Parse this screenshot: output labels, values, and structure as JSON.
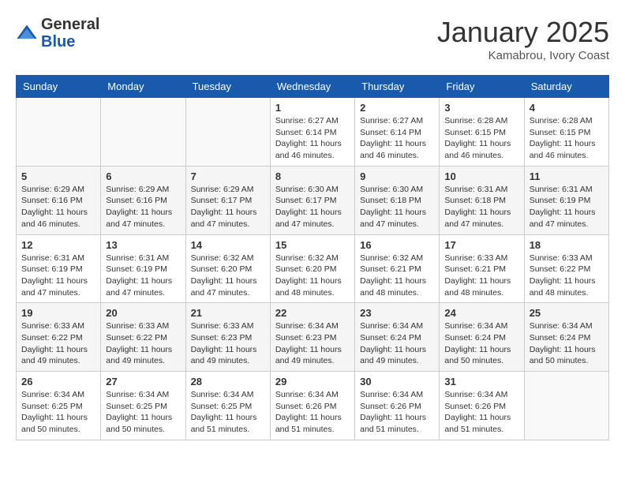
{
  "logo": {
    "general": "General",
    "blue": "Blue"
  },
  "header": {
    "month": "January 2025",
    "location": "Kamabrou, Ivory Coast"
  },
  "weekdays": [
    "Sunday",
    "Monday",
    "Tuesday",
    "Wednesday",
    "Thursday",
    "Friday",
    "Saturday"
  ],
  "weeks": [
    [
      {
        "day": "",
        "info": ""
      },
      {
        "day": "",
        "info": ""
      },
      {
        "day": "",
        "info": ""
      },
      {
        "day": "1",
        "info": "Sunrise: 6:27 AM\nSunset: 6:14 PM\nDaylight: 11 hours\nand 46 minutes."
      },
      {
        "day": "2",
        "info": "Sunrise: 6:27 AM\nSunset: 6:14 PM\nDaylight: 11 hours\nand 46 minutes."
      },
      {
        "day": "3",
        "info": "Sunrise: 6:28 AM\nSunset: 6:15 PM\nDaylight: 11 hours\nand 46 minutes."
      },
      {
        "day": "4",
        "info": "Sunrise: 6:28 AM\nSunset: 6:15 PM\nDaylight: 11 hours\nand 46 minutes."
      }
    ],
    [
      {
        "day": "5",
        "info": "Sunrise: 6:29 AM\nSunset: 6:16 PM\nDaylight: 11 hours\nand 46 minutes."
      },
      {
        "day": "6",
        "info": "Sunrise: 6:29 AM\nSunset: 6:16 PM\nDaylight: 11 hours\nand 47 minutes."
      },
      {
        "day": "7",
        "info": "Sunrise: 6:29 AM\nSunset: 6:17 PM\nDaylight: 11 hours\nand 47 minutes."
      },
      {
        "day": "8",
        "info": "Sunrise: 6:30 AM\nSunset: 6:17 PM\nDaylight: 11 hours\nand 47 minutes."
      },
      {
        "day": "9",
        "info": "Sunrise: 6:30 AM\nSunset: 6:18 PM\nDaylight: 11 hours\nand 47 minutes."
      },
      {
        "day": "10",
        "info": "Sunrise: 6:31 AM\nSunset: 6:18 PM\nDaylight: 11 hours\nand 47 minutes."
      },
      {
        "day": "11",
        "info": "Sunrise: 6:31 AM\nSunset: 6:19 PM\nDaylight: 11 hours\nand 47 minutes."
      }
    ],
    [
      {
        "day": "12",
        "info": "Sunrise: 6:31 AM\nSunset: 6:19 PM\nDaylight: 11 hours\nand 47 minutes."
      },
      {
        "day": "13",
        "info": "Sunrise: 6:31 AM\nSunset: 6:19 PM\nDaylight: 11 hours\nand 47 minutes."
      },
      {
        "day": "14",
        "info": "Sunrise: 6:32 AM\nSunset: 6:20 PM\nDaylight: 11 hours\nand 47 minutes."
      },
      {
        "day": "15",
        "info": "Sunrise: 6:32 AM\nSunset: 6:20 PM\nDaylight: 11 hours\nand 48 minutes."
      },
      {
        "day": "16",
        "info": "Sunrise: 6:32 AM\nSunset: 6:21 PM\nDaylight: 11 hours\nand 48 minutes."
      },
      {
        "day": "17",
        "info": "Sunrise: 6:33 AM\nSunset: 6:21 PM\nDaylight: 11 hours\nand 48 minutes."
      },
      {
        "day": "18",
        "info": "Sunrise: 6:33 AM\nSunset: 6:22 PM\nDaylight: 11 hours\nand 48 minutes."
      }
    ],
    [
      {
        "day": "19",
        "info": "Sunrise: 6:33 AM\nSunset: 6:22 PM\nDaylight: 11 hours\nand 49 minutes."
      },
      {
        "day": "20",
        "info": "Sunrise: 6:33 AM\nSunset: 6:22 PM\nDaylight: 11 hours\nand 49 minutes."
      },
      {
        "day": "21",
        "info": "Sunrise: 6:33 AM\nSunset: 6:23 PM\nDaylight: 11 hours\nand 49 minutes."
      },
      {
        "day": "22",
        "info": "Sunrise: 6:34 AM\nSunset: 6:23 PM\nDaylight: 11 hours\nand 49 minutes."
      },
      {
        "day": "23",
        "info": "Sunrise: 6:34 AM\nSunset: 6:24 PM\nDaylight: 11 hours\nand 49 minutes."
      },
      {
        "day": "24",
        "info": "Sunrise: 6:34 AM\nSunset: 6:24 PM\nDaylight: 11 hours\nand 50 minutes."
      },
      {
        "day": "25",
        "info": "Sunrise: 6:34 AM\nSunset: 6:24 PM\nDaylight: 11 hours\nand 50 minutes."
      }
    ],
    [
      {
        "day": "26",
        "info": "Sunrise: 6:34 AM\nSunset: 6:25 PM\nDaylight: 11 hours\nand 50 minutes."
      },
      {
        "day": "27",
        "info": "Sunrise: 6:34 AM\nSunset: 6:25 PM\nDaylight: 11 hours\nand 50 minutes."
      },
      {
        "day": "28",
        "info": "Sunrise: 6:34 AM\nSunset: 6:25 PM\nDaylight: 11 hours\nand 51 minutes."
      },
      {
        "day": "29",
        "info": "Sunrise: 6:34 AM\nSunset: 6:26 PM\nDaylight: 11 hours\nand 51 minutes."
      },
      {
        "day": "30",
        "info": "Sunrise: 6:34 AM\nSunset: 6:26 PM\nDaylight: 11 hours\nand 51 minutes."
      },
      {
        "day": "31",
        "info": "Sunrise: 6:34 AM\nSunset: 6:26 PM\nDaylight: 11 hours\nand 51 minutes."
      },
      {
        "day": "",
        "info": ""
      }
    ]
  ]
}
